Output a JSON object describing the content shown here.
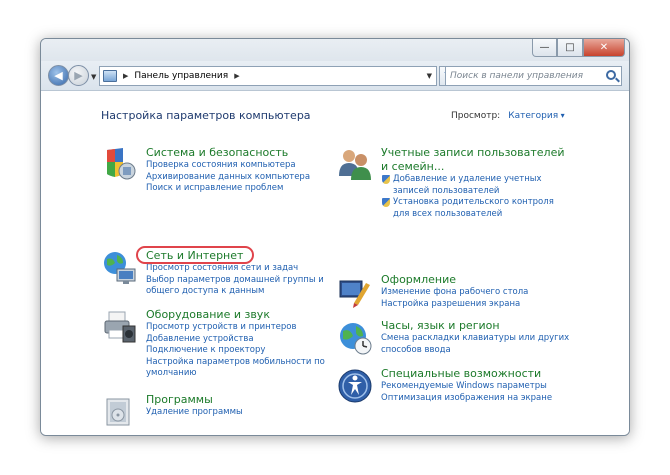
{
  "window": {
    "controls": {
      "minimize": "—",
      "maximize": "□",
      "close": "✕"
    }
  },
  "nav": {
    "address_path": [
      "Панель управления"
    ],
    "search_placeholder": "Поиск в панели управления"
  },
  "main": {
    "title": "Настройка параметров компьютера",
    "view_label": "Просмотр:",
    "view_value": "Категория"
  },
  "categories_left": [
    {
      "title": "Система и безопасность",
      "links": [
        "Проверка состояния компьютера",
        "Архивирование данных компьютера",
        "Поиск и исправление проблем"
      ]
    },
    {
      "title": "Сеть и Интернет",
      "links": [
        "Просмотр состояния сети и задач",
        "Выбор параметров домашней группы и общего доступа к данным"
      ]
    },
    {
      "title": "Оборудование и звук",
      "links": [
        "Просмотр устройств и принтеров",
        "Добавление устройства",
        "Подключение к проектору",
        "Настройка параметров мобильности по умолчанию"
      ]
    },
    {
      "title": "Программы",
      "links": [
        "Удаление программы"
      ]
    }
  ],
  "categories_right": [
    {
      "title": "Учетные записи пользователей и семейн...",
      "links": [
        "Добавление и удаление учетных записей пользователей",
        "Установка родительского контроля для всех пользователей"
      ]
    },
    {
      "title": "Оформление",
      "links": [
        "Изменение фона рабочего стола",
        "Настройка разрешения экрана"
      ]
    },
    {
      "title": "Часы, язык и регион",
      "links": [
        "Смена раскладки клавиатуры или других способов ввода"
      ]
    },
    {
      "title": "Специальные возможности",
      "links": [
        "Рекомендуемые Windows параметры",
        "Оптимизация изображения на экране"
      ]
    }
  ]
}
